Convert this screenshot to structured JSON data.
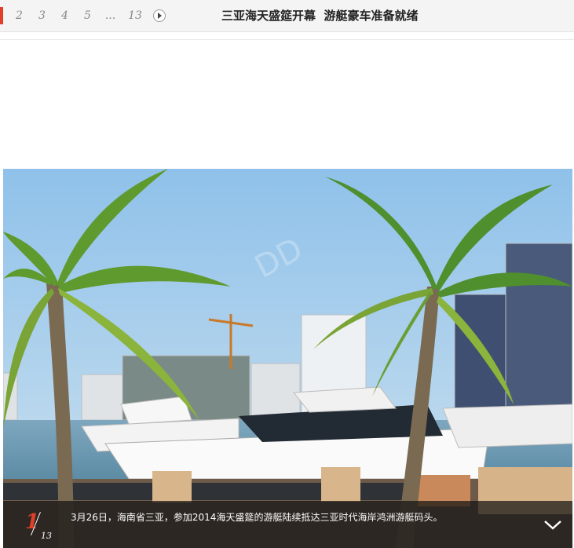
{
  "pager": {
    "pages": [
      "2",
      "3",
      "4",
      "5",
      "...",
      "13"
    ],
    "next_icon": "next-arrow-icon"
  },
  "title": "三亚海天盛筵开幕  游艇豪车准备就绪",
  "slide": {
    "current": "1",
    "total": "13",
    "caption": "3月26日，海南省三亚，参加2014海天盛筵的游艇陆续抵达三亚时代海岸鸿洲游艇码头。",
    "expand_icon": "chevron-down-icon"
  },
  "colors": {
    "accent": "#e0402a",
    "bar": "#f4f4f4",
    "sky": "#9fc8e8"
  }
}
